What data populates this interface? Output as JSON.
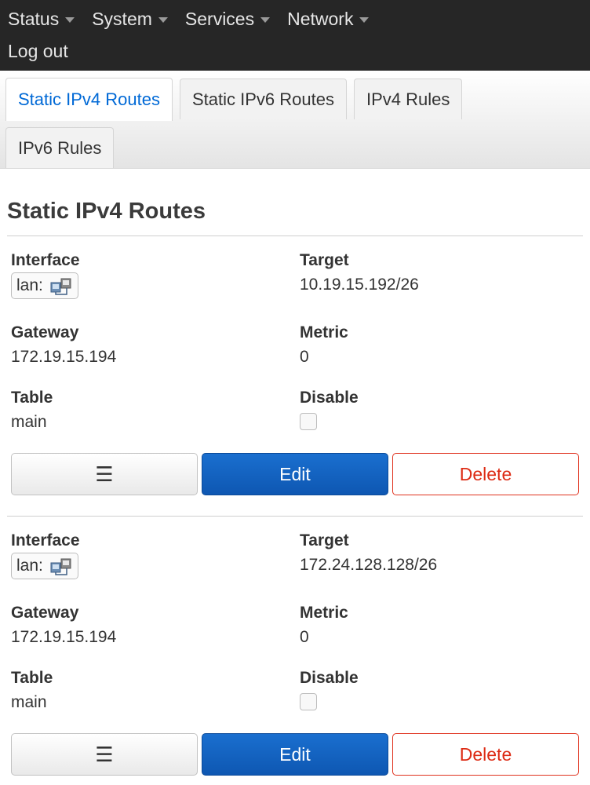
{
  "nav": {
    "menus": [
      "Status",
      "System",
      "Services",
      "Network"
    ],
    "logout": "Log out"
  },
  "tabs": [
    {
      "label": "Static IPv4 Routes",
      "active": true
    },
    {
      "label": "Static IPv6 Routes",
      "active": false
    },
    {
      "label": "IPv4 Rules",
      "active": false
    },
    {
      "label": "IPv6 Rules",
      "active": false
    }
  ],
  "page": {
    "title": "Static IPv4 Routes"
  },
  "labels": {
    "interface": "Interface",
    "target": "Target",
    "gateway": "Gateway",
    "metric": "Metric",
    "table": "Table",
    "disable": "Disable"
  },
  "buttons": {
    "menu": "☰",
    "edit": "Edit",
    "delete": "Delete"
  },
  "routes": [
    {
      "interface": "lan:",
      "target": "10.19.15.192/26",
      "gateway": "172.19.15.194",
      "metric": "0",
      "table": "main",
      "disabled": false
    },
    {
      "interface": "lan:",
      "target": "172.24.128.128/26",
      "gateway": "172.19.15.194",
      "metric": "0",
      "table": "main",
      "disabled": false
    }
  ],
  "colors": {
    "accent": "#0069d6",
    "edit": "#0e57b2",
    "delete": "#dd2b14",
    "header": "#262626"
  }
}
